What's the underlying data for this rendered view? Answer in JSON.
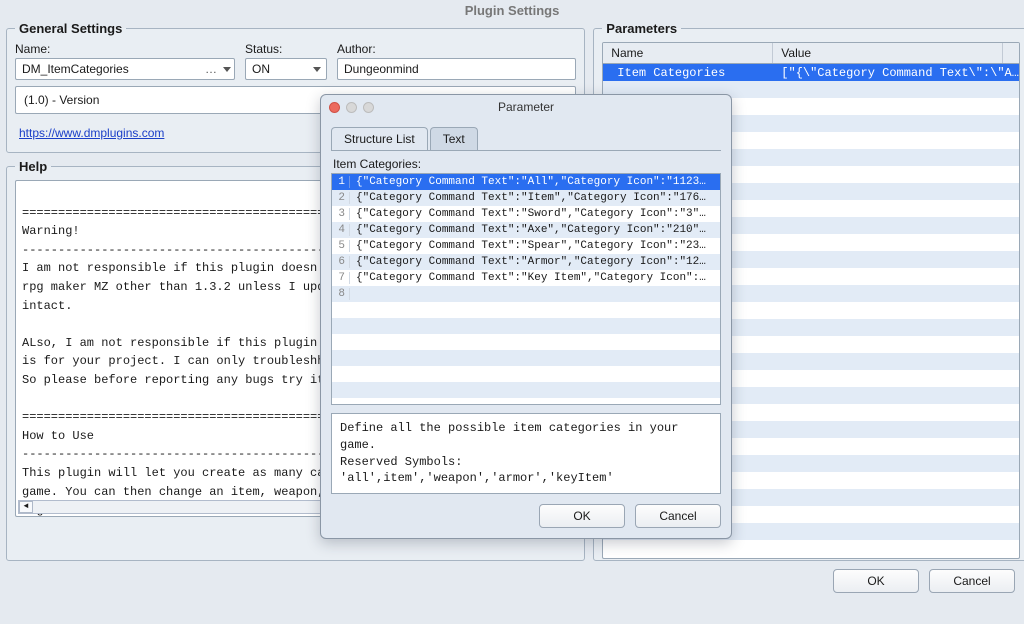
{
  "window_title": "Plugin Settings",
  "general": {
    "legend": "General Settings",
    "name_label": "Name:",
    "name_value": "DM_ItemCategories",
    "status_label": "Status:",
    "status_value": "ON",
    "author_label": "Author:",
    "author_value": "Dungeonmind",
    "version_line": "(1.0) - Version",
    "url": "https://www.dmplugins.com"
  },
  "help": {
    "legend": "Help",
    "text": "============================================================================\nWarning!\n----------------------------------------------------------------------------\nI am not responsible if this plugin doesn't work for other versions of\nrpg maker MZ other than 1.3.2 unless I update it for that version. Leave it\nintact.\n\nALso, I am not responsible if this plugin doesn't work because of the way it\nis for your project. I can only troubleshhoot it for you if it's my fault.\nSo please before reporting any bugs try it out in a fresh project first.\n\n============================================================================\nHow to Use\n----------------------------------------------------------------------------\nThis plugin will let you create as many categories as you want in your\ngame. You can then change an item, weapon, or armor category with a note\ntag."
  },
  "parameters": {
    "legend": "Parameters",
    "col_name": "Name",
    "col_value": "Value",
    "rows": [
      {
        "name": "Item Categories",
        "value": "[\"{\\\"Category Command Text\\\":\\\"A…"
      }
    ]
  },
  "main_buttons": {
    "ok": "OK",
    "cancel": "Cancel"
  },
  "modal": {
    "title": "Parameter",
    "tabs": {
      "structure": "Structure List",
      "text": "Text"
    },
    "list_label": "Item Categories:",
    "items": [
      "{\"Category Command Text\":\"All\",\"Category Icon\":\"1123…",
      "{\"Category Command Text\":\"Item\",\"Category Icon\":\"176…",
      "{\"Category Command Text\":\"Sword\",\"Category Icon\":\"3\"…",
      "{\"Category Command Text\":\"Axe\",\"Category Icon\":\"210\"…",
      "{\"Category Command Text\":\"Spear\",\"Category Icon\":\"23…",
      "{\"Category Command Text\":\"Armor\",\"Category Icon\":\"12…",
      "{\"Category Command Text\":\"Key Item\",\"Category Icon\":…"
    ],
    "description_l1": "Define all the possible item categories in your game.",
    "description_l2": "Reserved Symbols: 'all',item','weapon','armor','keyItem'",
    "ok": "OK",
    "cancel": "Cancel"
  }
}
